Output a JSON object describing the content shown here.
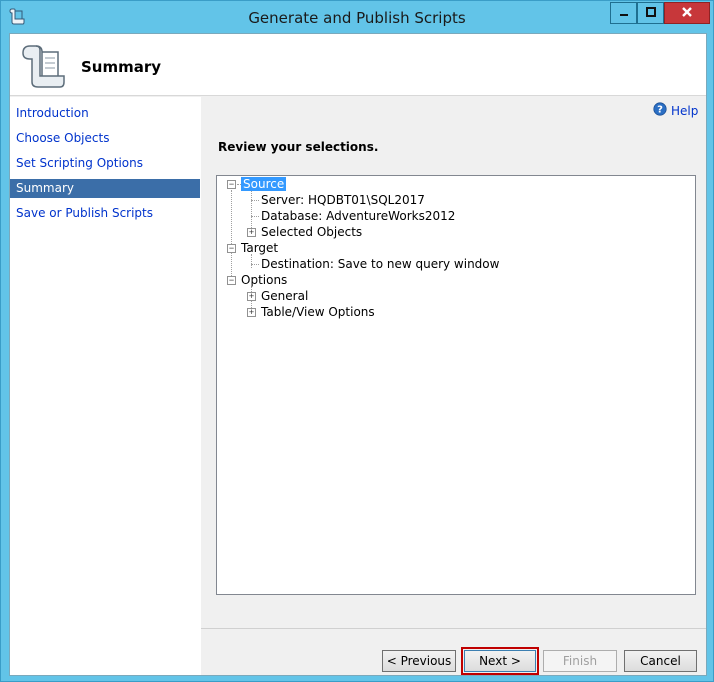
{
  "window": {
    "title": "Generate and Publish Scripts",
    "controls": {
      "minimize": "minimize-icon",
      "maximize": "maximize-icon",
      "close": "close-icon"
    }
  },
  "header": {
    "page_title": "Summary",
    "icon": "scroll-icon"
  },
  "nav": {
    "items": [
      {
        "label": "Introduction",
        "active": false
      },
      {
        "label": "Choose Objects",
        "active": false
      },
      {
        "label": "Set Scripting Options",
        "active": false
      },
      {
        "label": "Summary",
        "active": true
      },
      {
        "label": "Save or Publish Scripts",
        "active": false
      }
    ]
  },
  "main": {
    "help_label": "Help",
    "review_label": "Review your selections.",
    "tree": {
      "source": {
        "label": "Source",
        "children": [
          "Server: HQDBT01\\SQL2017",
          "Database: AdventureWorks2012",
          "Selected Objects"
        ]
      },
      "target": {
        "label": "Target",
        "children": [
          "Destination: Save to new query window"
        ]
      },
      "options": {
        "label": "Options",
        "children": [
          "General",
          "Table/View Options"
        ]
      }
    }
  },
  "footer": {
    "previous_label": "< Previous",
    "next_label": "Next >",
    "finish_label": "Finish",
    "cancel_label": "Cancel"
  },
  "colors": {
    "titlebar": "#62c4e8",
    "close_button": "#c7373a",
    "nav_active": "#3b6ea8",
    "tree_selection": "#3399ff",
    "link": "#0033cc"
  }
}
